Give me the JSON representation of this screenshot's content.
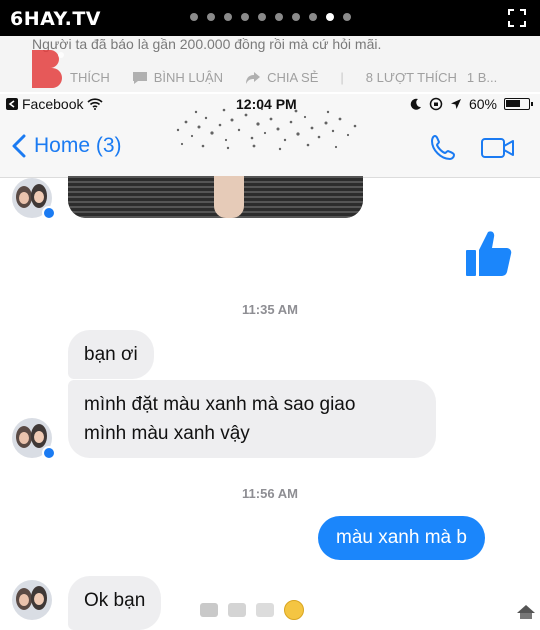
{
  "site": {
    "logo_text": "6HAY.TV",
    "slide_count": 10,
    "active_slide": 9
  },
  "post": {
    "caption": "Người ta đã báo là gần 200.000 đồng rồi mà cứ hỏi mãi.",
    "like_label": "THÍCH",
    "comment_label": "BÌNH LUẬN",
    "share_label": "CHIA SẺ",
    "likes_count": "8 LƯỢT THÍCH",
    "more_label": "1 B..."
  },
  "status_bar": {
    "carrier": "Facebook",
    "time": "12:04 PM",
    "battery": "60%"
  },
  "nav": {
    "back_label": "Home (3)"
  },
  "chat": {
    "timestamp_1": "11:35 AM",
    "msg_1": "bạn ơi",
    "msg_2_line1": "mình đặt màu xanh mà sao giao",
    "msg_2_line2": "mình màu xanh vậy",
    "timestamp_2": "11:56 AM",
    "reply_1": "màu xanh mà b",
    "msg_3": "Ok bạn"
  },
  "colors": {
    "messenger_blue": "#1b86fb",
    "bubble_gray": "#eeeef0",
    "link_blue": "#1b7bf2"
  }
}
